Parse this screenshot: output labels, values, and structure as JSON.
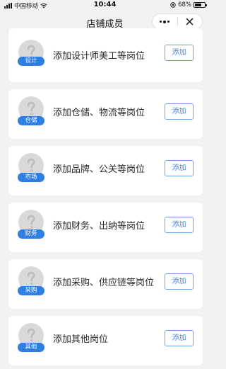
{
  "status_bar": {
    "carrier": "中国移动",
    "time": "10:44",
    "battery": "68%",
    "battery_level": 0.68
  },
  "nav": {
    "title": "店铺成员",
    "more_icon": "more-dots-icon",
    "close_icon": "close-icon"
  },
  "colors": {
    "accent": "#2f7fe0",
    "button_border": "#6ba3ea",
    "background": "#f2f2f2"
  },
  "roles": [
    {
      "badge": "设计",
      "label": "添加设计师美工等岗位",
      "button": "添加"
    },
    {
      "badge": "仓储",
      "label": "添加仓储、物流等岗位",
      "button": "添加"
    },
    {
      "badge": "市场",
      "label": "添加品牌、公关等岗位",
      "button": "添加"
    },
    {
      "badge": "财务",
      "label": "添加财务、出纳等岗位",
      "button": "添加"
    },
    {
      "badge": "采购",
      "label": "添加采购、供应链等岗位",
      "button": "添加"
    },
    {
      "badge": "其他",
      "label": "添加其他岗位",
      "button": "添加"
    }
  ]
}
